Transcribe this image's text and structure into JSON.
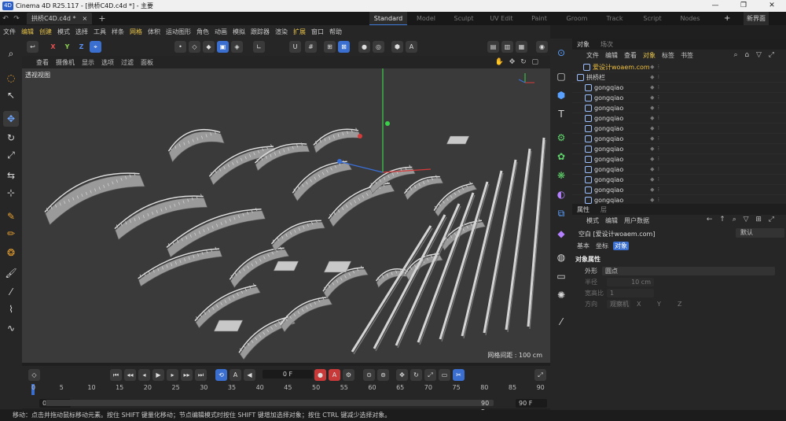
{
  "window": {
    "title": "Cinema 4D R25.117 - [拱桥C4D.c4d *] - 主要",
    "doc_tab": "拱桥C4D.c4d *",
    "doc_close": "×",
    "new_tab": "+",
    "min": "—",
    "restore": "❐",
    "close": "✕"
  },
  "layouts": [
    "Standard",
    "Model",
    "Sculpt",
    "UV Edit",
    "Paint",
    "Groom",
    "Track",
    "Script",
    "Nodes"
  ],
  "layout_plus": "+",
  "new_ui": "新界面",
  "menu": [
    "文件",
    "编辑",
    "创建",
    "模式",
    "选择",
    "工具",
    "样条",
    "网格",
    "体积",
    "运动图形",
    "角色",
    "动画",
    "模拟",
    "跟踪器",
    "渲染",
    "扩展",
    "窗口",
    "帮助"
  ],
  "top_tools": {
    "x": "X",
    "y": "Y",
    "z": "Z"
  },
  "viewport": {
    "menu": [
      "查看",
      "摄像机",
      "显示",
      "选项",
      "过滤",
      "面板"
    ],
    "label": "透视视图",
    "grid": "网格间距 : 100 cm"
  },
  "objects": {
    "tabs": [
      "对象",
      "场次"
    ],
    "menu": [
      "文件",
      "编辑",
      "查看",
      "对象",
      "标签",
      "书签"
    ],
    "items": [
      {
        "name": "爱设计woaem.com"
      },
      {
        "name": "拱桥栏"
      },
      {
        "name": "gongqiao"
      },
      {
        "name": "gongqiao"
      },
      {
        "name": "gongqiao"
      },
      {
        "name": "gongqiao"
      },
      {
        "name": "gongqiao"
      },
      {
        "name": "gongqiao"
      },
      {
        "name": "gongqiao"
      },
      {
        "name": "gongqiao"
      },
      {
        "name": "gongqiao"
      },
      {
        "name": "gongqiao"
      },
      {
        "name": "gongqiao"
      },
      {
        "name": "gongqiao"
      },
      {
        "name": "gongqiao"
      }
    ]
  },
  "attributes": {
    "tabs": [
      "属性",
      "层"
    ],
    "menu": [
      "模式",
      "编辑",
      "用户数据"
    ],
    "object": "空白 [爱设计woaem.com]",
    "mode": "默认",
    "sub_tabs": [
      "基本",
      "坐标",
      "对象"
    ],
    "section": "对象属性",
    "rows": [
      {
        "label": "外形",
        "value": "圆点"
      },
      {
        "label": "半径",
        "value": "10 cm"
      },
      {
        "label": "宽高比",
        "value": "1"
      },
      {
        "label": "方向",
        "value": "观察机"
      }
    ],
    "axes": [
      "X",
      "Y",
      "Z"
    ]
  },
  "timeline": {
    "current_frame": "0 F",
    "ticks": [
      "0",
      "5",
      "10",
      "15",
      "20",
      "25",
      "30",
      "35",
      "40",
      "45",
      "50",
      "55",
      "60",
      "65",
      "70",
      "75",
      "80",
      "85",
      "90"
    ],
    "start": "0 F",
    "start2": "0 F",
    "end": "90 F",
    "end2": "90 F"
  },
  "status": "移动：点击并拖动鼠标移动元素。按住 SHIFT 键量化移动；节点编辑模式时按住 SHIFT 键增加选择对象；按住 CTRL 键减少选择对象。"
}
